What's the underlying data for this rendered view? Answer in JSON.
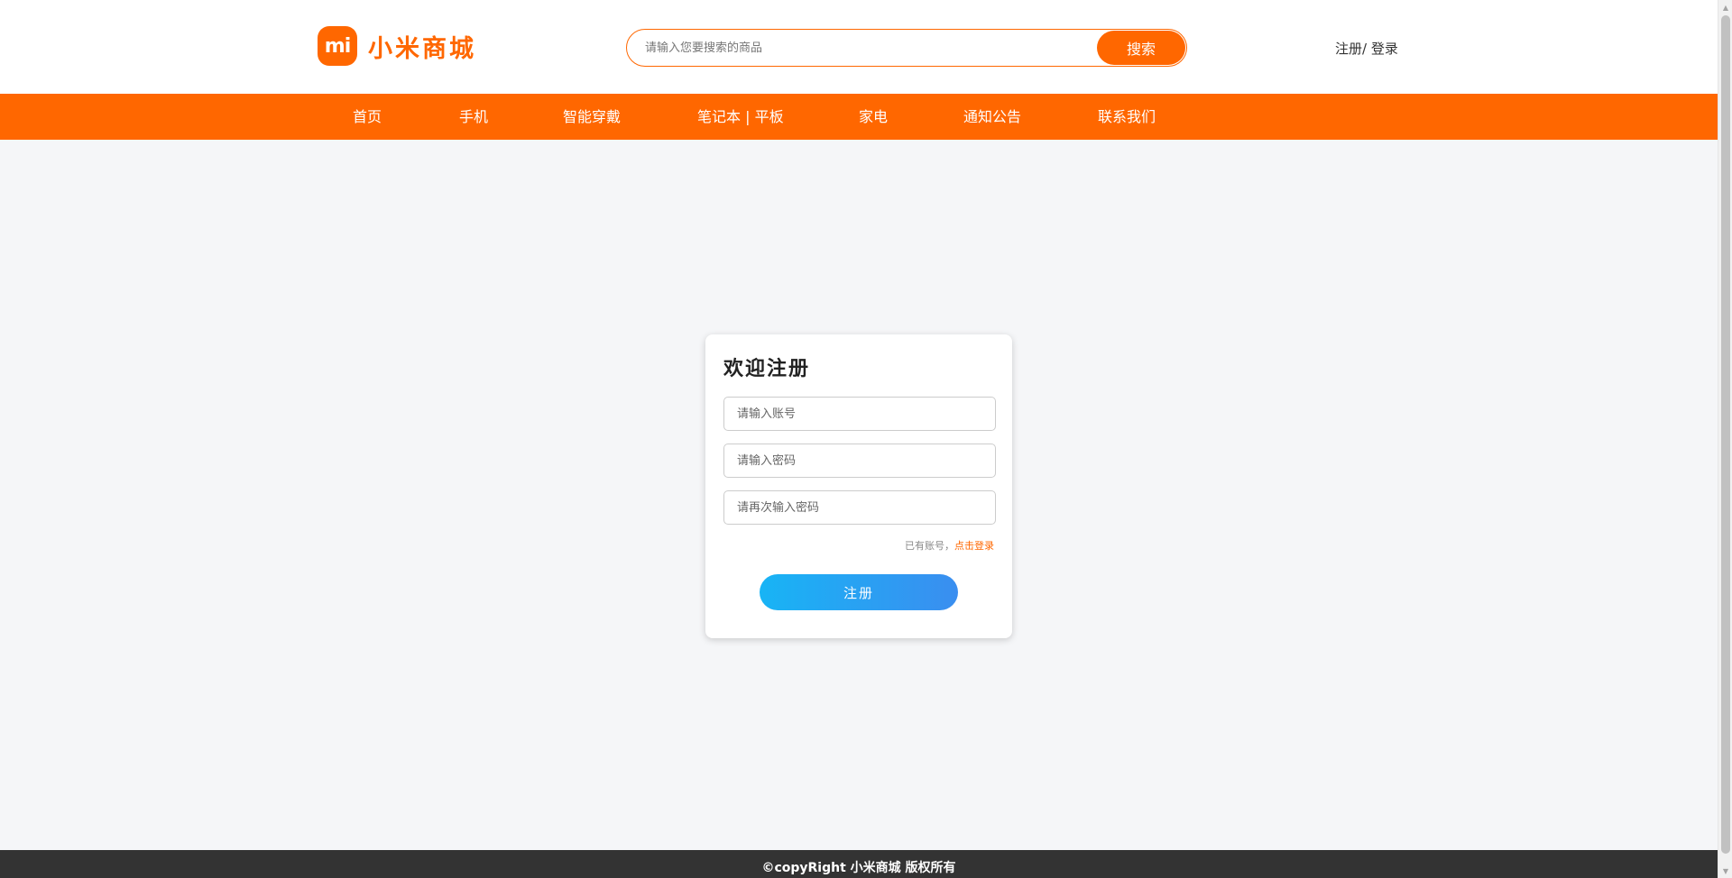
{
  "header": {
    "logo_mark": "mi",
    "logo_text": "小米商城",
    "search_placeholder": "请输入您要搜索的商品",
    "search_button": "搜索",
    "auth_register": "注册",
    "auth_separator": "/",
    "auth_login": " 登录"
  },
  "nav": {
    "items": [
      "首页",
      "手机",
      "智能穿戴",
      "笔记本 | 平板",
      "家电",
      "通知公告",
      "联系我们"
    ]
  },
  "form": {
    "title": "欢迎注册",
    "account_placeholder": "请输入账号",
    "password_placeholder": "请输入密码",
    "confirm_placeholder": "请再次输入密码",
    "hint_text": "已有账号，",
    "login_link": "点击登录",
    "submit_label": "注册"
  },
  "footer": {
    "copyright": "©copyRight 小米商城 版权所有"
  },
  "colors": {
    "brand": "#ff6700",
    "button_gradient_start": "#18b4f5",
    "button_gradient_end": "#3a8ef0",
    "footer_bg": "#333333"
  }
}
